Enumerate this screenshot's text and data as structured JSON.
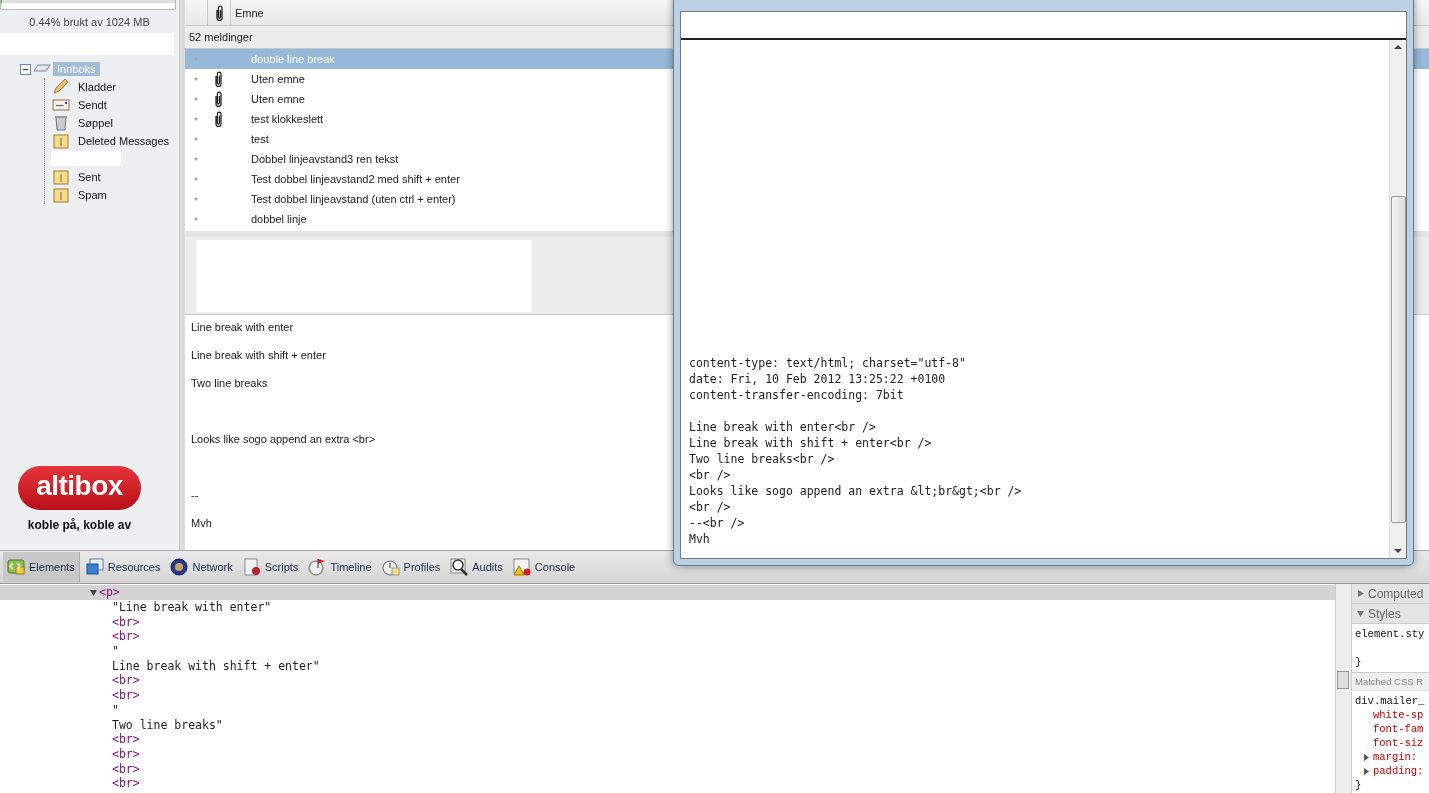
{
  "sidebar": {
    "quota": {
      "text": "0.44% brukt av 1024 MB",
      "level": 0.0044
    },
    "folders": [
      {
        "label": "Innboks",
        "kind": "inbox",
        "selected": true,
        "expanded": true,
        "children": [
          {
            "label": "Kladder",
            "kind": "drafts",
            "selected": false
          },
          {
            "label": "Sendt",
            "kind": "sent",
            "selected": false
          },
          {
            "label": "Søppel",
            "kind": "trash",
            "selected": false
          },
          {
            "label": "Deleted Messages",
            "kind": "folder",
            "selected": false
          },
          {
            "kind": "redacted"
          },
          {
            "label": "Sent",
            "kind": "folder",
            "selected": false
          },
          {
            "label": "Spam",
            "kind": "folder",
            "selected": false
          }
        ]
      }
    ],
    "logo": {
      "wordmark": "altibox",
      "tagline": "koble på, koble av"
    }
  },
  "message_list": {
    "column_3": "Emne",
    "count": "52 meldinger",
    "rows": [
      {
        "subject": "double line break",
        "attachment": false,
        "selected": true
      },
      {
        "subject": "Uten emne",
        "attachment": true,
        "selected": false
      },
      {
        "subject": "Uten emne",
        "attachment": true,
        "selected": false
      },
      {
        "subject": "test klokkeslett",
        "attachment": true,
        "selected": false
      },
      {
        "subject": "test",
        "attachment": false,
        "selected": false
      },
      {
        "subject": "Dobbel linjeavstand3 ren tekst",
        "attachment": false,
        "selected": false
      },
      {
        "subject": "Test dobbel linjeavstand2 med shift + enter",
        "attachment": false,
        "selected": false
      },
      {
        "subject": "Test dobbel linjeavstand (uten ctrl + enter)",
        "attachment": false,
        "selected": false
      },
      {
        "subject": "dobbel linje",
        "attachment": false,
        "selected": false
      }
    ]
  },
  "preview": {
    "lines": [
      {
        "kind": "text",
        "text": "Line break with enter"
      },
      {
        "kind": "text",
        "text": "Line break with shift + enter"
      },
      {
        "kind": "text",
        "text": "Two line breaks"
      },
      {
        "kind": "blank"
      },
      {
        "kind": "text",
        "text": "Looks like sogo append an extra <br>"
      },
      {
        "kind": "blank"
      },
      {
        "kind": "text",
        "text": "--"
      },
      {
        "kind": "text",
        "text": "Mvh"
      }
    ]
  },
  "source_window": {
    "lines": [
      {
        "kind": "text",
        "text": "content-type: text/html; charset=\"utf-8\""
      },
      {
        "kind": "text",
        "text": "date: Fri, 10 Feb 2012 13:25:22 +0100"
      },
      {
        "kind": "text",
        "text": "content-transfer-encoding: 7bit"
      },
      {
        "kind": "blank"
      },
      {
        "kind": "text",
        "text": "Line break with enter<br />"
      },
      {
        "kind": "text",
        "text": "Line break with shift + enter<br />"
      },
      {
        "kind": "text",
        "text": "Two line breaks<br />"
      },
      {
        "kind": "text",
        "text": "<br />"
      },
      {
        "kind": "text",
        "text": "Looks like sogo append an extra &lt;br&gt;<br />"
      },
      {
        "kind": "text",
        "text": "<br />"
      },
      {
        "kind": "text",
        "text": "--<br />"
      },
      {
        "kind": "text",
        "text": "Mvh"
      }
    ]
  },
  "devtools": {
    "tabs": [
      {
        "label": "Elements",
        "selected": true
      },
      {
        "label": "Resources",
        "selected": false
      },
      {
        "label": "Network",
        "selected": false
      },
      {
        "label": "Scripts",
        "selected": false
      },
      {
        "label": "Timeline",
        "selected": false
      },
      {
        "label": "Profiles",
        "selected": false
      },
      {
        "label": "Audits",
        "selected": false
      },
      {
        "label": "Console",
        "selected": false
      }
    ],
    "dom_tree": [
      {
        "kind": "tag",
        "text": "<p>",
        "expanded": true,
        "selected": true,
        "children": [
          {
            "kind": "text",
            "text": "\"Line break with enter\""
          },
          {
            "kind": "tag",
            "text": "<br>"
          },
          {
            "kind": "tag",
            "text": "<br>"
          },
          {
            "kind": "text",
            "text": "\""
          },
          {
            "kind": "text",
            "text": "Line break with shift + enter\""
          },
          {
            "kind": "tag",
            "text": "<br>"
          },
          {
            "kind": "tag",
            "text": "<br>"
          },
          {
            "kind": "text",
            "text": "\""
          },
          {
            "kind": "text",
            "text": "Two line breaks\""
          },
          {
            "kind": "tag",
            "text": "<br>"
          },
          {
            "kind": "tag",
            "text": "<br>"
          },
          {
            "kind": "tag",
            "text": "<br>"
          },
          {
            "kind": "tag",
            "text": "<br>"
          }
        ]
      }
    ],
    "styles_pane": {
      "sections": [
        {
          "kind": "header",
          "title": "Computed",
          "expanded": false
        },
        {
          "kind": "header",
          "title": "Styles",
          "expanded": true
        },
        {
          "kind": "code",
          "lines": [
            {
              "kind": "selector",
              "text": "element.sty"
            },
            {
              "kind": "blank"
            },
            {
              "kind": "selector",
              "text": "}"
            }
          ]
        },
        {
          "kind": "subheader",
          "title": "Matched CSS R"
        },
        {
          "kind": "code",
          "lines": [
            {
              "kind": "selector",
              "text": "div.mailer_"
            },
            {
              "kind": "property",
              "text": "white-sp",
              "expandable": false
            },
            {
              "kind": "property",
              "text": "font-fam",
              "expandable": false
            },
            {
              "kind": "property",
              "text": "font-siz",
              "expandable": false
            },
            {
              "kind": "property",
              "text": "margin:",
              "expandable": true
            },
            {
              "kind": "property",
              "text": "padding:",
              "expandable": true
            },
            {
              "kind": "selector",
              "text": "}"
            }
          ]
        }
      ]
    }
  }
}
